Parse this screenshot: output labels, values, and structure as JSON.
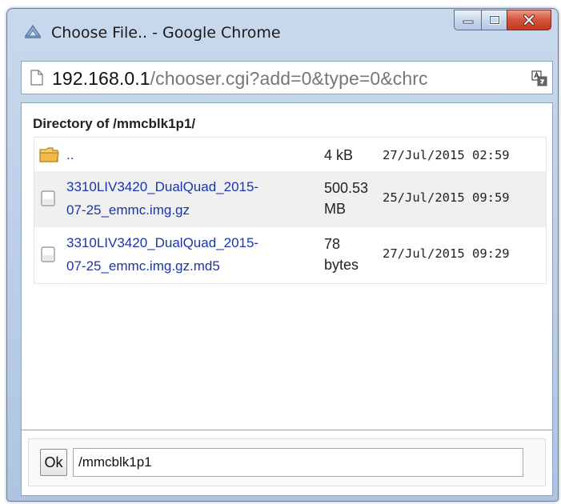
{
  "window": {
    "title": "Choose File.. - Google Chrome"
  },
  "address_bar": {
    "host": "192.168.0.1",
    "path": "/chooser.cgi?add=0&type=0&chrc"
  },
  "directory": {
    "heading": "Directory of /mmcblk1p1/"
  },
  "files": [
    {
      "type": "folder",
      "name_line1": "..",
      "name_line2": "",
      "size_line1": "4 kB",
      "size_line2": "",
      "date": "27/Jul/2015 02:59"
    },
    {
      "type": "file",
      "name_line1": "3310LIV3420_DualQuad_2015-",
      "name_line2": "07-25_emmc.img.gz",
      "size_line1": "500.53",
      "size_line2": "MB",
      "date": "25/Jul/2015 09:59"
    },
    {
      "type": "file",
      "name_line1": "3310LIV3420_DualQuad_2015-",
      "name_line2": "07-25_emmc.img.gz.md5",
      "size_line1": "78",
      "size_line2": "bytes",
      "date": "27/Jul/2015 09:29"
    }
  ],
  "footer": {
    "ok_label": "Ok",
    "path_value": "/mmcblk1p1"
  },
  "colors": {
    "link": "#1a35a8",
    "close_button": "#c13a22",
    "folder": "#f2b84b"
  }
}
